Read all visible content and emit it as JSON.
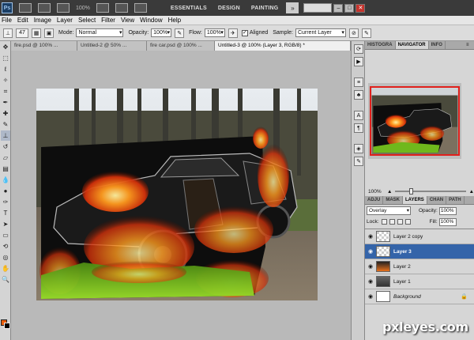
{
  "appbar": {
    "logo": "Ps",
    "zoom": "100%",
    "workspaces": [
      "ESSENTIALS",
      "DESIGN",
      "PAINTING"
    ],
    "more": "»",
    "window_buttons": [
      "–",
      "□",
      "✕"
    ]
  },
  "menu": [
    "File",
    "Edit",
    "Image",
    "Layer",
    "Select",
    "Filter",
    "View",
    "Window",
    "Help"
  ],
  "options": {
    "brush_size": "47",
    "mode_label": "Mode:",
    "mode_value": "Normal",
    "opacity_label": "Opacity:",
    "opacity_value": "100%",
    "flow_label": "Flow:",
    "flow_value": "100%",
    "aligned_label": "Aligned",
    "sample_label": "Sample:",
    "sample_value": "Current Layer"
  },
  "tabs": [
    {
      "label": "fire.psd @ 100% ..."
    },
    {
      "label": "Untitled-2 @ 50% ..."
    },
    {
      "label": "fire car.psd @ 100% ..."
    },
    {
      "label": "Untitled-3 @ 100% (Layer 3, RGB/8) *"
    }
  ],
  "panels": {
    "top_tabs": [
      "HISTOGRA",
      "NAVIGATOR",
      "INFO"
    ],
    "nav_zoom": "100%",
    "layers_tabs": [
      "ADJU",
      "MASK",
      "LAYERS",
      "CHAN",
      "PATH"
    ],
    "blend_mode": "Overlay",
    "opacity_label": "Opacity:",
    "opacity_value": "100%",
    "lock_label": "Lock:",
    "fill_label": "Fill:",
    "fill_value": "100%"
  },
  "layers": [
    {
      "name": "Layer 2 copy",
      "selected": false
    },
    {
      "name": "Layer 3",
      "selected": true
    },
    {
      "name": "Layer 2",
      "selected": false
    },
    {
      "name": "Layer 1",
      "selected": false
    },
    {
      "name": "Background",
      "selected": false,
      "locked": true
    }
  ],
  "watermark": "pxleyes.com",
  "colors": {
    "foreground": "#e85c0c",
    "background": "#000000",
    "selection": "#3464a9"
  }
}
